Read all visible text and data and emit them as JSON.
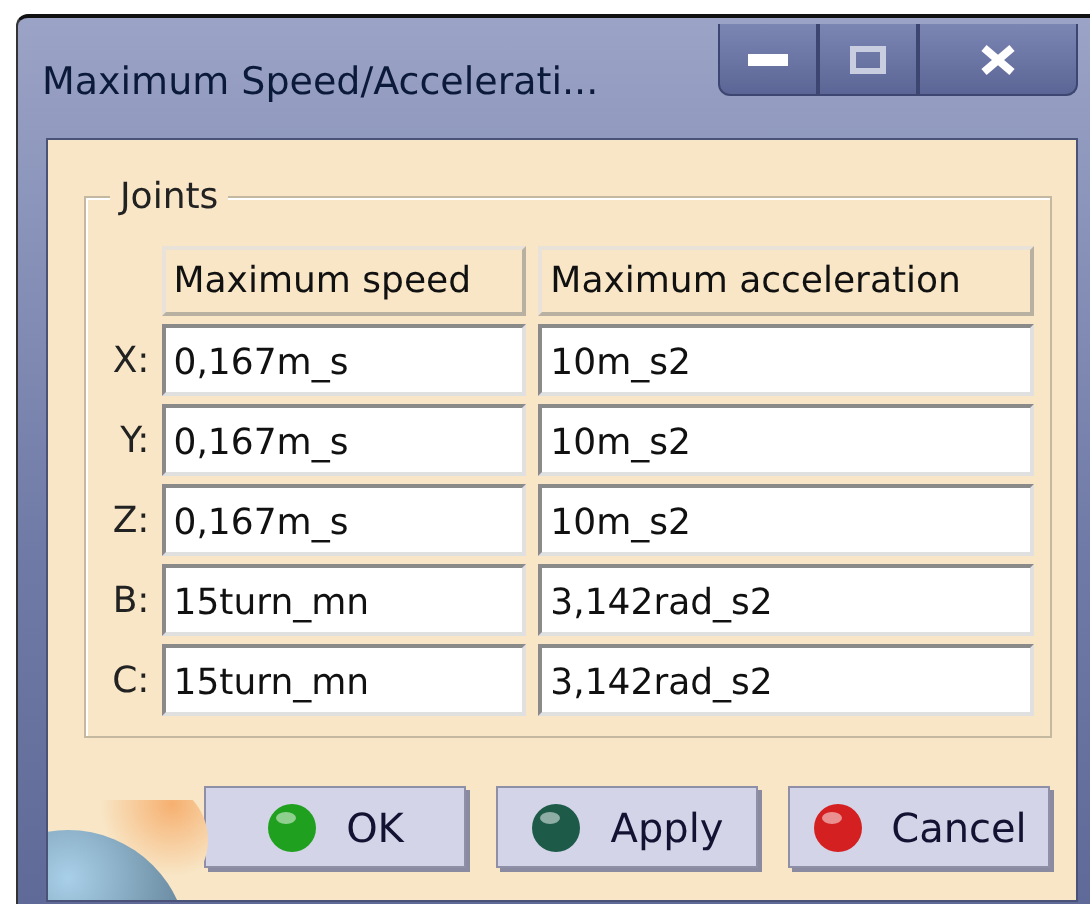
{
  "window": {
    "title": "Maximum Speed/Accelerati..."
  },
  "group": {
    "title": "Joints"
  },
  "columns": [
    "Maximum speed",
    "Maximum acceleration"
  ],
  "rows": [
    {
      "label": "X:",
      "speed": "0,167m_s",
      "acceleration": "10m_s2"
    },
    {
      "label": "Y:",
      "speed": "0,167m_s",
      "acceleration": "10m_s2"
    },
    {
      "label": "Z:",
      "speed": "0,167m_s",
      "acceleration": "10m_s2"
    },
    {
      "label": "B:",
      "speed": "15turn_mn",
      "acceleration": "3,142rad_s2"
    },
    {
      "label": "C:",
      "speed": "15turn_mn",
      "acceleration": "3,142rad_s2"
    }
  ],
  "buttons": [
    {
      "label": "OK",
      "color": "#1fa01f"
    },
    {
      "label": "Apply",
      "color": "#1d5a48"
    },
    {
      "label": "Cancel",
      "color": "#d42020"
    }
  ]
}
